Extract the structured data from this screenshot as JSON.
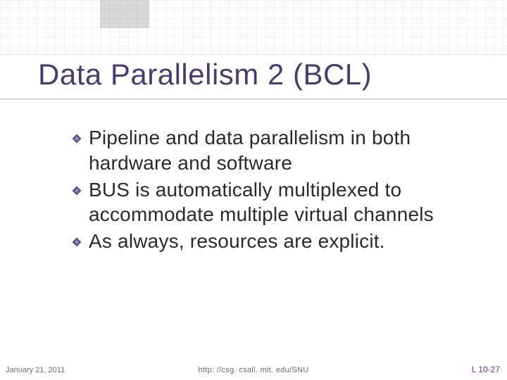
{
  "slide": {
    "title": "Data Parallelism 2 (BCL)",
    "bullets": [
      "Pipeline and data parallelism in both hardware and software",
      "BUS is automatically multiplexed to accommodate multiple virtual channels",
      "As always, resources are explicit."
    ]
  },
  "footer": {
    "date": "January 21, 2011",
    "url": "http: //csg. csail. mit. edu/SNU",
    "slide_number": "L 10-27"
  }
}
